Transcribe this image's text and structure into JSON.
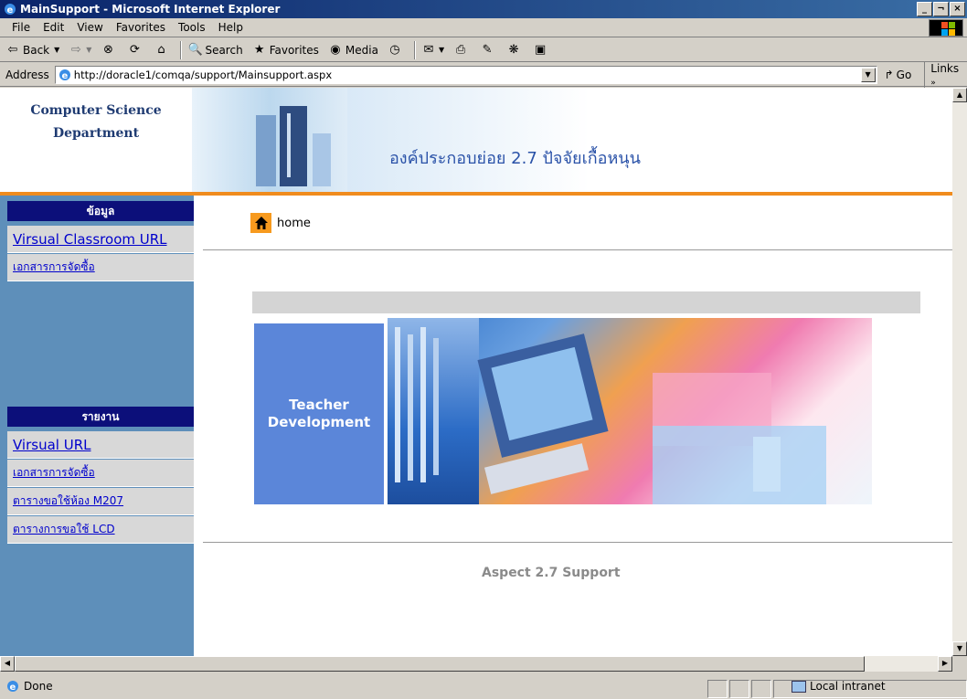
{
  "window": {
    "title": "MainSupport - Microsoft Internet Explorer",
    "controls": [
      "_",
      "¬",
      "×"
    ]
  },
  "menu": [
    "File",
    "Edit",
    "View",
    "Favorites",
    "Tools",
    "Help"
  ],
  "toolbar": {
    "back": "Back",
    "search": "Search",
    "favorites": "Favorites",
    "media": "Media"
  },
  "address": {
    "label": "Address",
    "url": "http://doracle1/comqa/support/Mainsupport.aspx",
    "go": "Go",
    "links": "Links"
  },
  "header": {
    "logo_line1": "Computer Science",
    "logo_line2": "Department",
    "title": "องค์ประกอบย่อย 2.7 ปัจจัยเกื้อหนุน"
  },
  "sidebar": {
    "section1_title": "ข้อมูล",
    "section1_links": [
      "Virsual Classroom URL",
      "เอกสารการจัดซื้อ"
    ],
    "section2_title": "รายงาน",
    "section2_links": [
      "Virsual URL",
      "เอกสารการจัดซื้อ",
      "ตารางขอใช้ห้อง M207",
      "ตารางการขอใช้ LCD"
    ]
  },
  "main": {
    "home_label": "home",
    "banner_line1": "Teacher",
    "banner_line2": "Development",
    "footer_text": "Aspect 2.7 Support"
  },
  "status": {
    "text": "Done",
    "zone": "Local intranet"
  }
}
